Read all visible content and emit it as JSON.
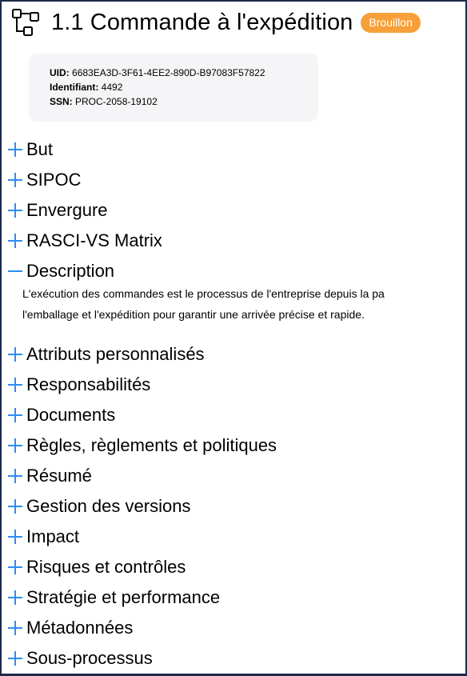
{
  "header": {
    "title": "1.1 Commande à l'expédition",
    "status_badge": "Brouillon",
    "icon": "process-flow-icon"
  },
  "meta": {
    "uid_label": "UID:",
    "uid_value": "6683EA3D-3F61-4EE2-890D-B97083F57822",
    "id_label": "Identifiant:",
    "id_value": "4492",
    "ssn_label": "SSN:",
    "ssn_value": "PROC-2058-19102"
  },
  "sections": [
    {
      "label": "But",
      "expanded": false
    },
    {
      "label": "SIPOC",
      "expanded": false
    },
    {
      "label": "Envergure",
      "expanded": false
    },
    {
      "label": "RASCI-VS Matrix",
      "expanded": false
    },
    {
      "label": "Description",
      "expanded": true
    },
    {
      "label": "Attributs personnalisés",
      "expanded": false
    },
    {
      "label": "Responsabilités",
      "expanded": false
    },
    {
      "label": "Documents",
      "expanded": false
    },
    {
      "label": "Règles, règlements et politiques",
      "expanded": false
    },
    {
      "label": "Résumé",
      "expanded": false
    },
    {
      "label": "Gestion des versions",
      "expanded": false
    },
    {
      "label": "Impact",
      "expanded": false
    },
    {
      "label": "Risques et contrôles",
      "expanded": false
    },
    {
      "label": "Stratégie et performance",
      "expanded": false
    },
    {
      "label": "Métadonnées",
      "expanded": false
    },
    {
      "label": "Sous-processus",
      "expanded": false
    }
  ],
  "description": {
    "line1": "L'exécution des commandes est le processus de l'entreprise depuis la pa",
    "line2": "l'emballage et l'expédition pour garantir une arrivée précise et rapide."
  },
  "colors": {
    "accent": "#2f8cf0",
    "badge": "#f7a03a",
    "meta_bg": "#f5f5f7",
    "frame": "#1c2a4a"
  }
}
